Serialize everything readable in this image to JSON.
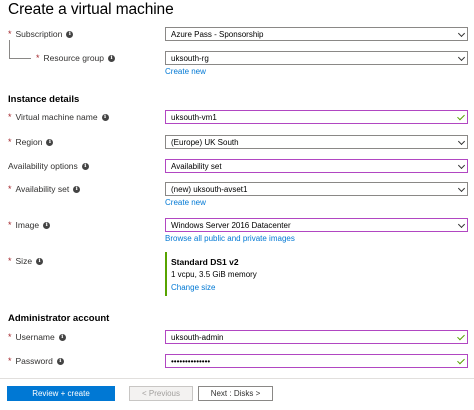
{
  "page": {
    "title": "Create a virtual machine"
  },
  "subscription": {
    "label": "Subscription",
    "value": "Azure Pass - Sponsorship"
  },
  "resource_group": {
    "label": "Resource group",
    "value": "uksouth-rg",
    "create_new": "Create new"
  },
  "instance_details": {
    "heading": "Instance details",
    "vm_name": {
      "label": "Virtual machine name",
      "value": "uksouth-vm1"
    },
    "region": {
      "label": "Region",
      "value": "(Europe) UK South"
    },
    "availability_options": {
      "label": "Availability options",
      "value": "Availability set"
    },
    "availability_set": {
      "label": "Availability set",
      "value": "(new) uksouth-avset1",
      "create_new": "Create new"
    },
    "image": {
      "label": "Image",
      "value": "Windows Server 2016 Datacenter",
      "browse": "Browse all public and private images"
    },
    "size": {
      "label": "Size",
      "name": "Standard DS1 v2",
      "spec": "1 vcpu, 3.5 GiB memory",
      "change": "Change size"
    }
  },
  "admin_account": {
    "heading": "Administrator account",
    "username": {
      "label": "Username",
      "value": "uksouth-admin"
    },
    "password": {
      "label": "Password",
      "value": "••••••••••••••"
    }
  },
  "footer": {
    "review_create": "Review + create",
    "previous": "< Previous",
    "next": "Next : Disks >"
  },
  "colors": {
    "accent": "#0078d4",
    "valid_border": "#b146c2",
    "check": "#57a300",
    "required": "#a4262c"
  },
  "icons": {
    "info": "info-icon",
    "dropdown": "chevron-down-icon",
    "valid": "checkmark-icon"
  }
}
